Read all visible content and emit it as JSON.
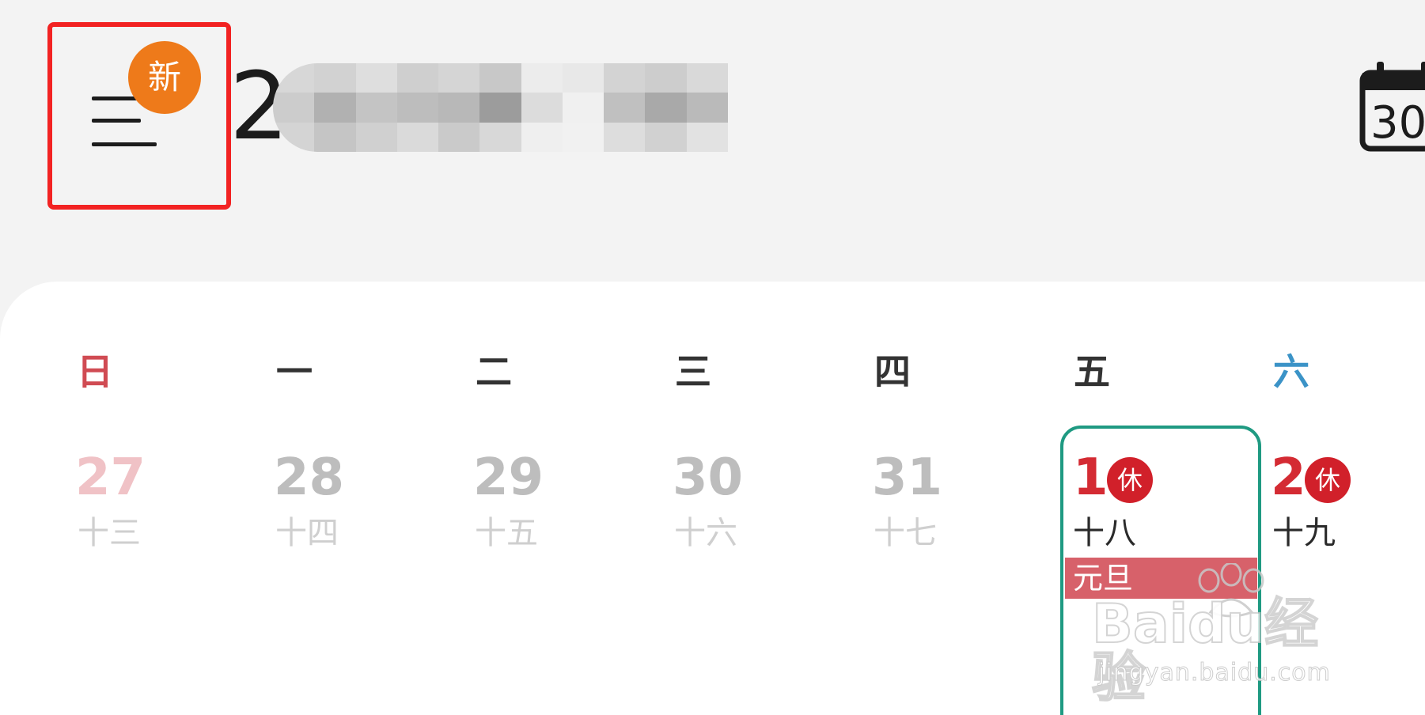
{
  "header": {
    "menu_badge": "新",
    "title_visible": "2"
  },
  "weekdays": [
    "日",
    "一",
    "二",
    "三",
    "四",
    "五",
    "六"
  ],
  "days": [
    {
      "number": "27",
      "lunar": "十三"
    },
    {
      "number": "28",
      "lunar": "十四"
    },
    {
      "number": "29",
      "lunar": "十五"
    },
    {
      "number": "30",
      "lunar": "十六"
    },
    {
      "number": "31",
      "lunar": "十七"
    },
    {
      "number": "1",
      "lunar": "十八",
      "rest_badge": "休",
      "festival": "元旦"
    },
    {
      "number": "2",
      "lunar": "十九",
      "rest_badge": "休"
    }
  ],
  "today_button": {
    "date": "30"
  },
  "watermark": {
    "logo": "Baidu经验",
    "url": "jingyan.baidu.com"
  },
  "colors": {
    "accent_orange": "#ee7a1a",
    "selection_border": "#f22222",
    "today_frame": "#1f9a82",
    "holiday_red": "#d42b33",
    "festival_tag": "#d7616a",
    "saturday_blue": "#3b93c7",
    "sunday_red": "#d04b53"
  }
}
